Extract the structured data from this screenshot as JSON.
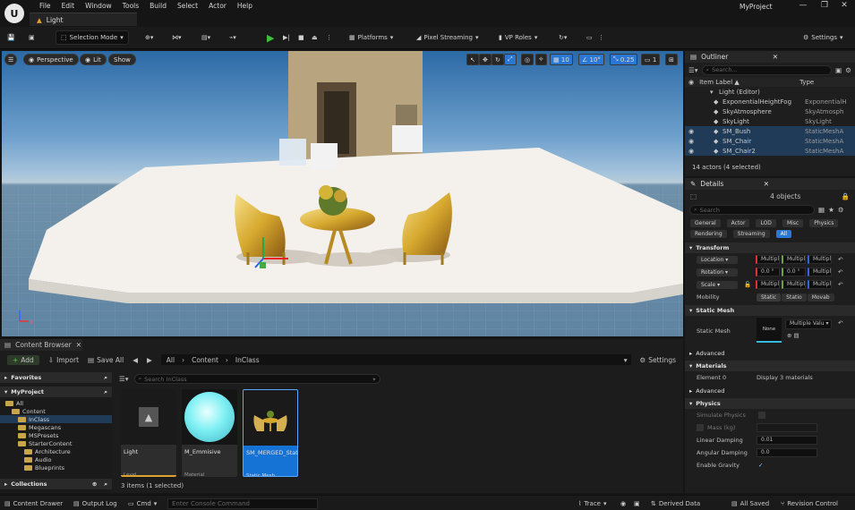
{
  "window": {
    "menu": [
      "File",
      "Edit",
      "Window",
      "Tools",
      "Build",
      "Select",
      "Actor",
      "Help"
    ],
    "level_tab": "Light",
    "project": "MyProject",
    "min": "—",
    "max": "❐",
    "close": "✕"
  },
  "toolbar": {
    "selection_mode": "Selection Mode",
    "platforms": "Platforms",
    "pixel_streaming": "Pixel Streaming",
    "vp_roles": "VP Roles",
    "settings": "Settings"
  },
  "viewport": {
    "perspective": "Perspective",
    "lit": "Lit",
    "show": "Show",
    "grid_size": "10",
    "angle": "10°",
    "scale": "0.25",
    "cam_speed": "1"
  },
  "outliner": {
    "title": "Outliner",
    "search_placeholder": "Search...",
    "col_label": "Item Label ▲",
    "col_type": "Type",
    "rows": [
      {
        "label": "Light (Editor)",
        "type": "",
        "eye": false,
        "sel": false
      },
      {
        "label": "ExponentialHeightFog",
        "type": "ExponentialH",
        "eye": false,
        "sel": false
      },
      {
        "label": "SkyAtmosphere",
        "type": "SkyAtmosph",
        "eye": false,
        "sel": false
      },
      {
        "label": "SkyLight",
        "type": "SkyLight",
        "eye": false,
        "sel": false
      },
      {
        "label": "SM_Bush",
        "type": "StaticMeshA",
        "eye": true,
        "sel": true
      },
      {
        "label": "SM_Chair",
        "type": "StaticMeshA",
        "eye": true,
        "sel": true
      },
      {
        "label": "SM_Chair2",
        "type": "StaticMeshA",
        "eye": true,
        "sel": true
      }
    ],
    "status": "14 actors (4 selected)"
  },
  "details": {
    "title": "Details",
    "objects": "4 objects",
    "search_placeholder": "Search",
    "filters": [
      "General",
      "Actor",
      "LOD",
      "Misc",
      "Physics",
      "Rendering",
      "Streaming",
      "All"
    ],
    "transform": "Transform",
    "location": "Location",
    "rotation": "Rotation",
    "scale": "Scale",
    "multiple": "Multipl",
    "zero": "0.0 °",
    "mobility": "Mobility",
    "mob_opts": [
      "Static",
      "Statio",
      "Movab"
    ],
    "static_mesh_sect": "Static Mesh",
    "static_mesh": "Static Mesh",
    "none": "None",
    "multiple_values": "Multiple Valu",
    "advanced": "Advanced",
    "materials": "Materials",
    "element0": "Element 0",
    "display_materials": "Display 3 materials",
    "physics": "Physics",
    "simulate": "Simulate Physics",
    "mass": "Mass (kg)",
    "linear": "Linear Damping",
    "linear_val": "0.01",
    "angular": "Angular Damping",
    "angular_val": "0.0",
    "gravity": "Enable Gravity"
  },
  "content_browser": {
    "tab": "Content Browser",
    "add": "Add",
    "import": "Import",
    "save_all": "Save All",
    "path": [
      "All",
      "Content",
      "InClass"
    ],
    "settings": "Settings",
    "favorites": "Favorites",
    "project": "MyProject",
    "search_placeholder": "Search InClass",
    "search_proj": "Search MyProject",
    "collections": "Collections",
    "tree": [
      "All",
      "Content",
      "InClass",
      "Megascans",
      "MSPresets",
      "StarterContent",
      "Architecture",
      "Audio",
      "Blueprints"
    ],
    "assets": [
      {
        "name": "Light",
        "type": "Level"
      },
      {
        "name": "M_Emmisive",
        "type": "Material"
      },
      {
        "name": "SM_MERGED_StaticMeshActor_10",
        "type": "Static Mesh"
      }
    ],
    "count": "3 items (1 selected)"
  },
  "status": {
    "content_drawer": "Content Drawer",
    "output_log": "Output Log",
    "cmd": "Cmd",
    "console_placeholder": "Enter Console Command",
    "trace": "Trace",
    "derived": "Derived Data",
    "all_saved": "All Saved",
    "revision": "Revision Control"
  }
}
